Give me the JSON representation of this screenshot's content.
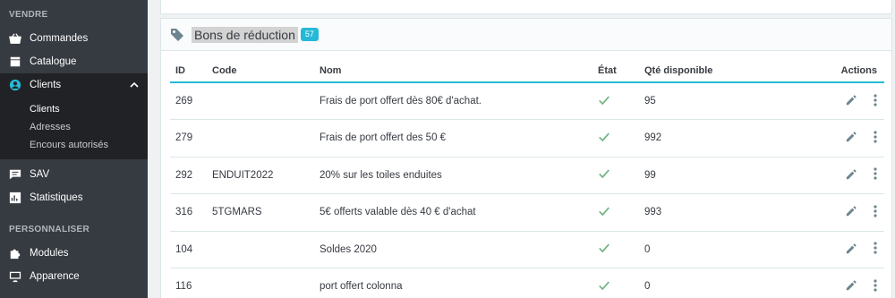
{
  "sidebar": {
    "section_sell": "VENDRE",
    "items": [
      {
        "label": "Commandes",
        "icon": "basket-icon"
      },
      {
        "label": "Catalogue",
        "icon": "store-icon"
      },
      {
        "label": "Clients",
        "icon": "user-circle-icon",
        "active": true
      }
    ],
    "clients_sub": [
      "Clients",
      "Adresses",
      "Encours autorisés"
    ],
    "items_after": [
      {
        "label": "SAV",
        "icon": "chat-icon"
      },
      {
        "label": "Statistiques",
        "icon": "bar-chart-icon"
      }
    ],
    "section_customize": "PERSONNALISER",
    "items_customize": [
      {
        "label": "Modules",
        "icon": "puzzle-icon"
      },
      {
        "label": "Apparence",
        "icon": "monitor-icon"
      }
    ]
  },
  "card": {
    "title": "Bons de réduction",
    "count": "57"
  },
  "table": {
    "headers": {
      "id": "ID",
      "code": "Code",
      "nom": "Nom",
      "etat": "État",
      "qte": "Qté disponible",
      "actions": "Actions"
    },
    "rows": [
      {
        "id": "269",
        "code": "",
        "nom": "Frais de port offert dès 80€ d'achat.",
        "qte": "95"
      },
      {
        "id": "279",
        "code": "",
        "nom": "Frais de port offert des 50 €",
        "qte": "992"
      },
      {
        "id": "292",
        "code": "ENDUIT2022",
        "nom": "20% sur les toiles enduites",
        "qte": "99"
      },
      {
        "id": "316",
        "code": "5TGMARS",
        "nom": "5€ offerts valable dès 40 € d'achat",
        "qte": "993"
      },
      {
        "id": "104",
        "code": "",
        "nom": "Soldes 2020",
        "qte": "0"
      },
      {
        "id": "116",
        "code": "",
        "nom": "port offert colonna",
        "qte": "0"
      }
    ]
  },
  "colors": {
    "accent": "#25b9d7",
    "sidebar_bg": "#363a41",
    "check": "#70b580"
  }
}
